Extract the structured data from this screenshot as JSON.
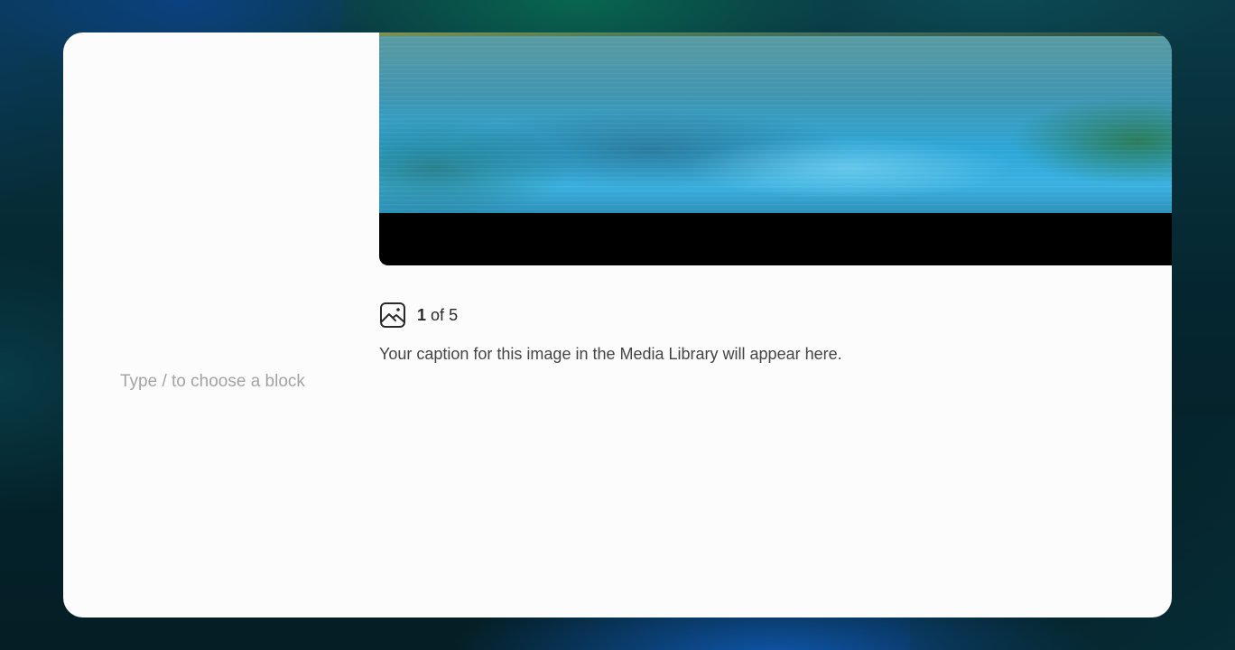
{
  "editor": {
    "block_placeholder": "Type / to choose a block"
  },
  "gallery": {
    "image_description_icon": "image-icon",
    "counter": {
      "current": "1",
      "separator": "of",
      "total": "5"
    },
    "caption": "Your caption for this image in the Media Library will appear here."
  }
}
